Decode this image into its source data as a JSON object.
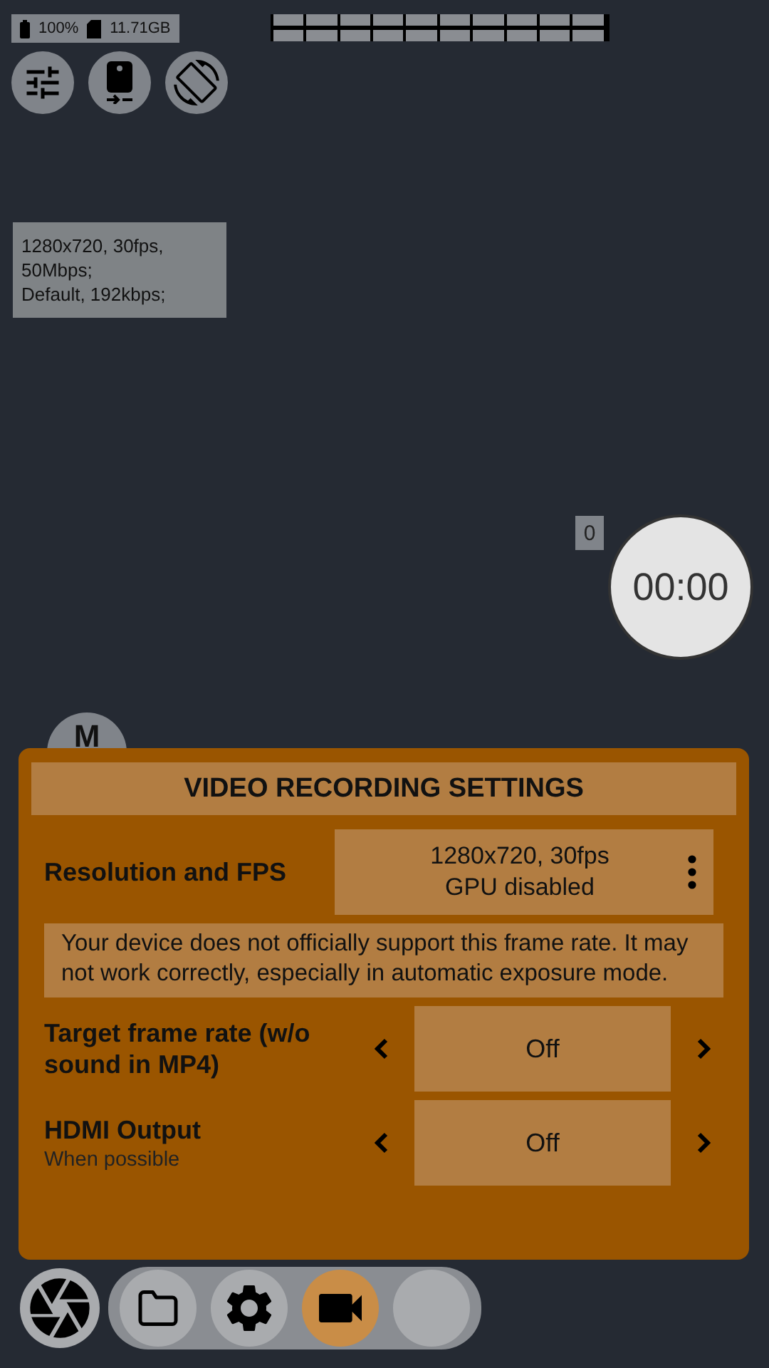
{
  "status": {
    "battery": "100%",
    "storage": "11.71GB"
  },
  "info": {
    "lines": [
      "1280x720, 30fps, 50Mbps;",
      "Default, 192kbps;"
    ]
  },
  "counter": "0",
  "timer": "00:00",
  "mode_button": "M",
  "dialog": {
    "title": "VIDEO RECORDING SETTINGS",
    "resolution": {
      "label": "Resolution and FPS",
      "value_lines": [
        "1280x720, 30fps",
        "GPU disabled"
      ]
    },
    "warning": "Your device does not officially support this frame rate. It may not work correctly, especially in automatic exposure mode.",
    "settings": [
      {
        "label": "Target frame rate (w/o sound in MP4)",
        "value": "Off"
      },
      {
        "label": "HDMI Output",
        "sublabel": "When possible",
        "value": "Off"
      }
    ]
  },
  "bottom_bar": [
    {
      "kind": "shutter",
      "selected": false
    },
    {
      "kind": "folder",
      "selected": false
    },
    {
      "kind": "settings",
      "selected": false
    },
    {
      "kind": "video",
      "selected": true
    },
    {
      "kind": "blank",
      "selected": false
    }
  ]
}
